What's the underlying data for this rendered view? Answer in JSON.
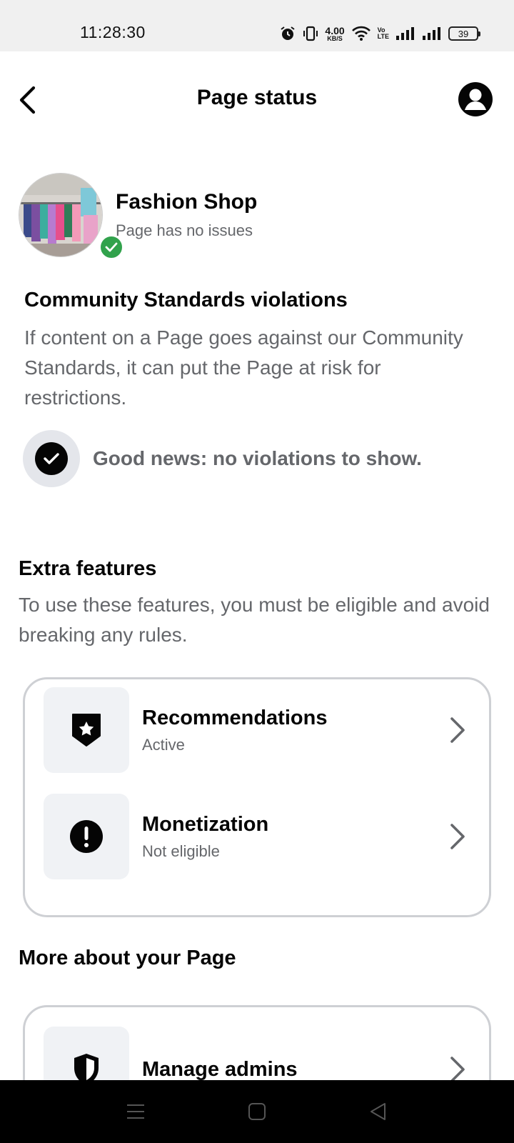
{
  "status_bar": {
    "time": "11:28:30",
    "net_speed_value": "4.00",
    "net_speed_unit": "KB/S",
    "volte_top": "Vo",
    "volte_bottom": "LTE",
    "battery": "39",
    "icons": [
      "alarm-icon",
      "vibrate-icon",
      "wifi-icon",
      "signal-icon",
      "signal-icon",
      "battery-icon"
    ]
  },
  "header": {
    "title": "Page status",
    "back_icon": "back-arrow-icon",
    "profile_icon": "profile-icon"
  },
  "page_info": {
    "name": "Fashion Shop",
    "status": "Page has no issues",
    "badge_color": "#31a24c"
  },
  "community": {
    "title": "Community Standards violations",
    "description": "If content on a Page goes against our Community Standards, it can put the Page at risk for restrictions.",
    "good_news": "Good news: no violations to show."
  },
  "extra_features": {
    "title": "Extra features",
    "description": "To use these features, you must be eligible and avoid breaking any rules.",
    "items": [
      {
        "title": "Recommendations",
        "status": "Active",
        "icon": "star-shield-icon"
      },
      {
        "title": "Monetization",
        "status": "Not eligible",
        "icon": "alert-icon"
      }
    ]
  },
  "more_about": {
    "title": "More about your Page",
    "items": [
      {
        "title": "Manage admins",
        "icon": "shield-icon"
      }
    ]
  },
  "nav": {
    "icons": [
      "menu-icon",
      "home-icon",
      "back-icon"
    ]
  }
}
